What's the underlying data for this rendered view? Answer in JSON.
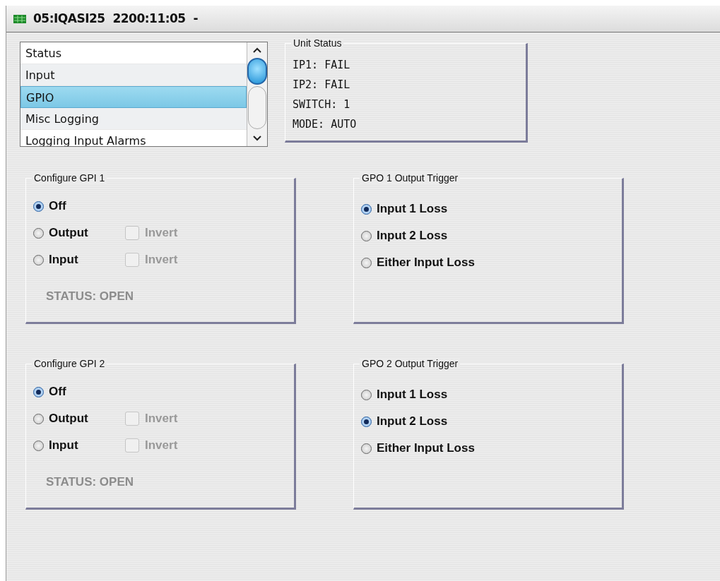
{
  "window": {
    "title": "05:IQASI25  2200:11:05  -"
  },
  "nav_list": {
    "items": [
      {
        "label": "Status",
        "selected": false
      },
      {
        "label": "Input",
        "selected": false
      },
      {
        "label": "GPIO",
        "selected": true
      },
      {
        "label": "Misc Logging",
        "selected": false
      },
      {
        "label": "Logging Input Alarms",
        "selected": false
      }
    ]
  },
  "unit_status": {
    "title": "Unit Status",
    "lines": [
      "IP1: FAIL",
      "IP2: FAIL",
      "SWITCH: 1",
      "MODE: AUTO"
    ]
  },
  "panel_rows": [
    {
      "gpi": {
        "title": "Configure GPI 1",
        "options": [
          {
            "label": "Off",
            "selected": true
          },
          {
            "label": "Output",
            "selected": false,
            "invert": {
              "label": "Invert",
              "checked": false,
              "disabled": true
            }
          },
          {
            "label": "Input",
            "selected": false,
            "invert": {
              "label": "Invert",
              "checked": false,
              "disabled": true
            }
          }
        ],
        "status": "STATUS: OPEN"
      },
      "gpo": {
        "title": "GPO 1 Output Trigger",
        "options": [
          {
            "label": "Input 1 Loss",
            "selected": true
          },
          {
            "label": "Input 2 Loss",
            "selected": false
          },
          {
            "label": "Either Input Loss",
            "selected": false
          }
        ]
      }
    },
    {
      "gpi": {
        "title": "Configure GPI 2",
        "options": [
          {
            "label": "Off",
            "selected": true
          },
          {
            "label": "Output",
            "selected": false,
            "invert": {
              "label": "Invert",
              "checked": false,
              "disabled": true
            }
          },
          {
            "label": "Input",
            "selected": false,
            "invert": {
              "label": "Invert",
              "checked": false,
              "disabled": true
            }
          }
        ],
        "status": "STATUS: OPEN"
      },
      "gpo": {
        "title": "GPO 2 Output Trigger",
        "options": [
          {
            "label": "Input 1 Loss",
            "selected": false
          },
          {
            "label": "Input 2 Loss",
            "selected": true
          },
          {
            "label": "Either Input Loss",
            "selected": false
          }
        ]
      }
    }
  ]
}
